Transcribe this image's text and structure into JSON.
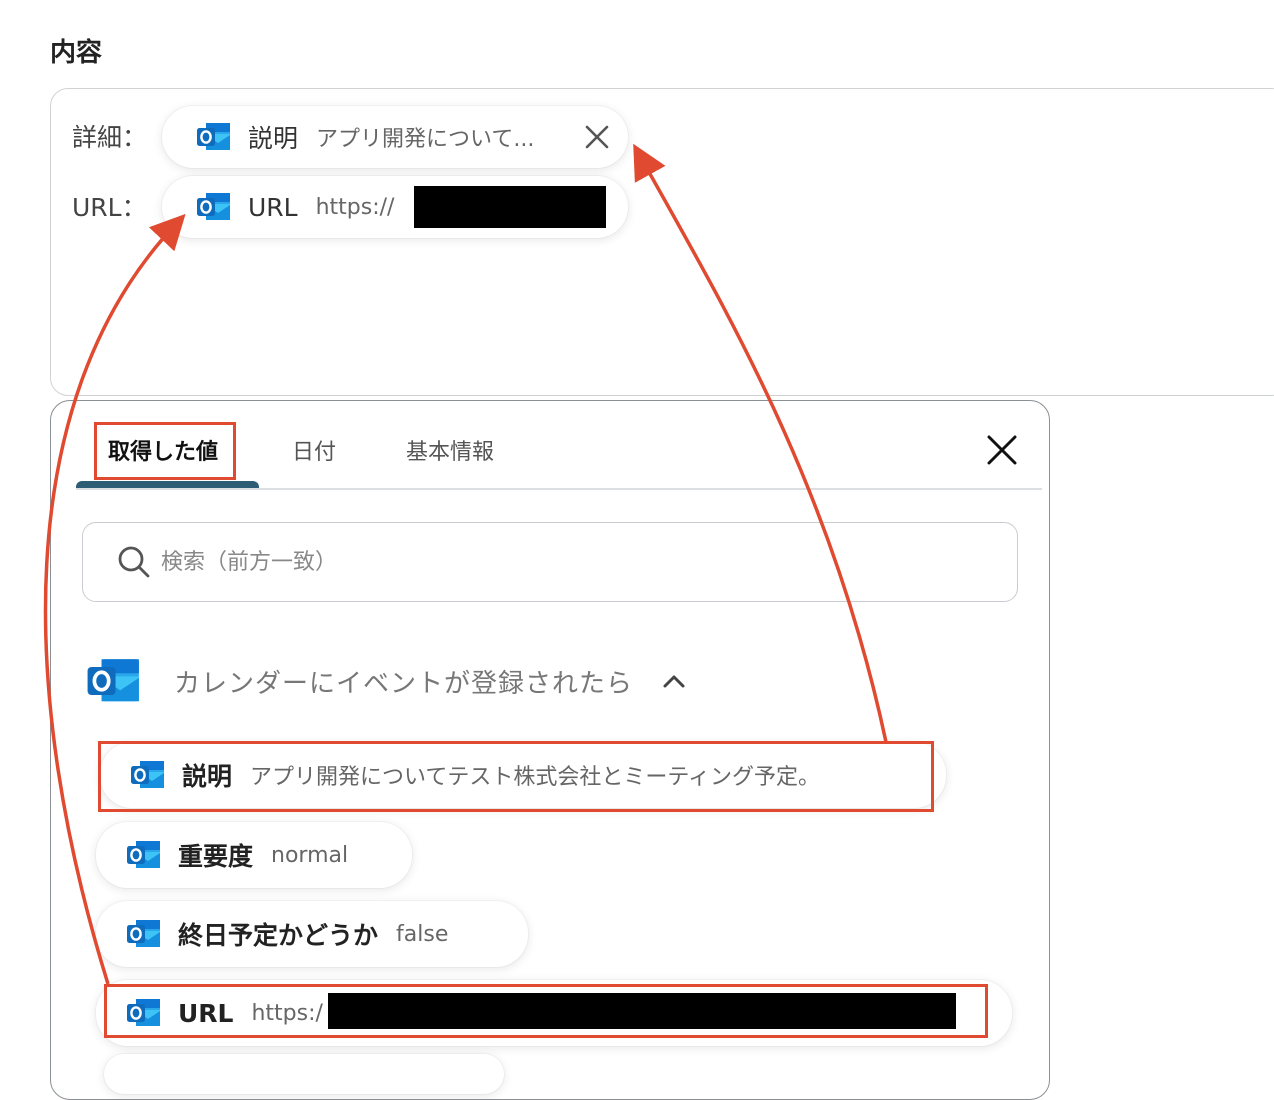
{
  "section_title": "内容",
  "fields": [
    {
      "label": "詳細：",
      "token_name": "説明",
      "token_value": "アプリ開発について..."
    },
    {
      "label": "URL：",
      "token_name": "URL",
      "token_value": "https://"
    }
  ],
  "picker": {
    "tabs": [
      {
        "label": "取得した値",
        "active": true
      },
      {
        "label": "日付",
        "active": false
      },
      {
        "label": "基本情報",
        "active": false
      }
    ],
    "search_placeholder": "検索（前方一致）",
    "group_title": "カレンダーにイベントが登録されたら",
    "items": [
      {
        "name": "説明",
        "value": "アプリ開発についてテスト株式会社とミーティング予定。"
      },
      {
        "name": "重要度",
        "value": "normal"
      },
      {
        "name": "終日予定かどうか",
        "value": "false"
      },
      {
        "name": "URL",
        "value": "https:/"
      }
    ]
  },
  "colors": {
    "highlight": "#e04a30",
    "tab_underline": "#2d5d74",
    "outlook_blue": "#0f6cbd"
  },
  "icons": [
    "outlook-icon",
    "close-icon",
    "search-icon",
    "chevron-up-icon"
  ]
}
